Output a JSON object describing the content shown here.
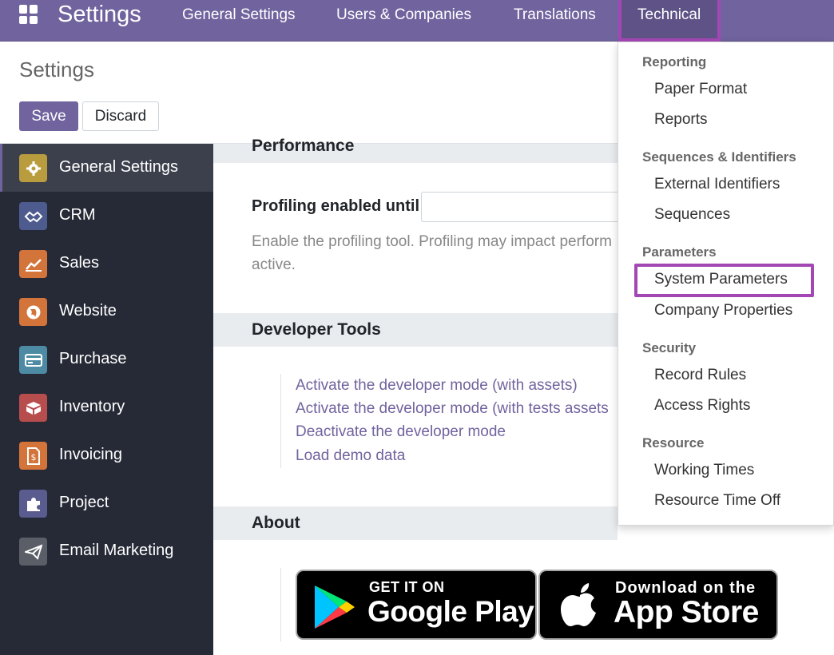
{
  "navbar": {
    "brand": "Settings",
    "menus": [
      "General Settings",
      "Users & Companies",
      "Translations",
      "Technical"
    ]
  },
  "control_panel": {
    "title": "Settings",
    "save_label": "Save",
    "discard_label": "Discard"
  },
  "sidebar": {
    "items": [
      {
        "label": "General Settings",
        "icon": "gear-icon",
        "color": "#b89c3d"
      },
      {
        "label": "CRM",
        "icon": "handshake-icon",
        "color": "#4e5b8e"
      },
      {
        "label": "Sales",
        "icon": "chart-icon",
        "color": "#d3743a"
      },
      {
        "label": "Website",
        "icon": "globe-icon",
        "color": "#d3743a"
      },
      {
        "label": "Purchase",
        "icon": "card-icon",
        "color": "#4d8ba4"
      },
      {
        "label": "Inventory",
        "icon": "box-icon",
        "color": "#b84d4d"
      },
      {
        "label": "Invoicing",
        "icon": "invoice-icon",
        "color": "#d3743a"
      },
      {
        "label": "Project",
        "icon": "puzzle-icon",
        "color": "#5a5b8f"
      },
      {
        "label": "Email Marketing",
        "icon": "paper-plane-icon",
        "color": "#5a5e66"
      }
    ]
  },
  "main": {
    "performance": {
      "title": "Performance",
      "profiling_label": "Profiling enabled until",
      "profiling_help": "Enable the profiling tool. Profiling may impact perform",
      "profiling_help_2": "active."
    },
    "developer_tools": {
      "title": "Developer Tools",
      "links": [
        "Activate the developer mode (with assets)",
        "Activate the developer mode (with tests assets",
        "Deactivate the developer mode",
        "Load demo data"
      ]
    },
    "about": {
      "title": "About",
      "google_play_small": "GET IT ON",
      "google_play_big": "Google Play",
      "app_store_small": "Download on the",
      "app_store_big": "App Store"
    }
  },
  "dropdown": {
    "groups": [
      {
        "header": "Reporting",
        "items": [
          "Paper Format",
          "Reports"
        ]
      },
      {
        "header": "Sequences & Identifiers",
        "items": [
          "External Identifiers",
          "Sequences"
        ]
      },
      {
        "header": "Parameters",
        "items": [
          "System Parameters",
          "Company Properties"
        ]
      },
      {
        "header": "Security",
        "items": [
          "Record Rules",
          "Access Rights"
        ]
      },
      {
        "header": "Resource",
        "items": [
          "Working Times",
          "Resource Time Off"
        ]
      }
    ]
  },
  "colors": {
    "brand": "#71639e",
    "highlight": "#a347b5",
    "sidebar_bg": "#262a36"
  }
}
